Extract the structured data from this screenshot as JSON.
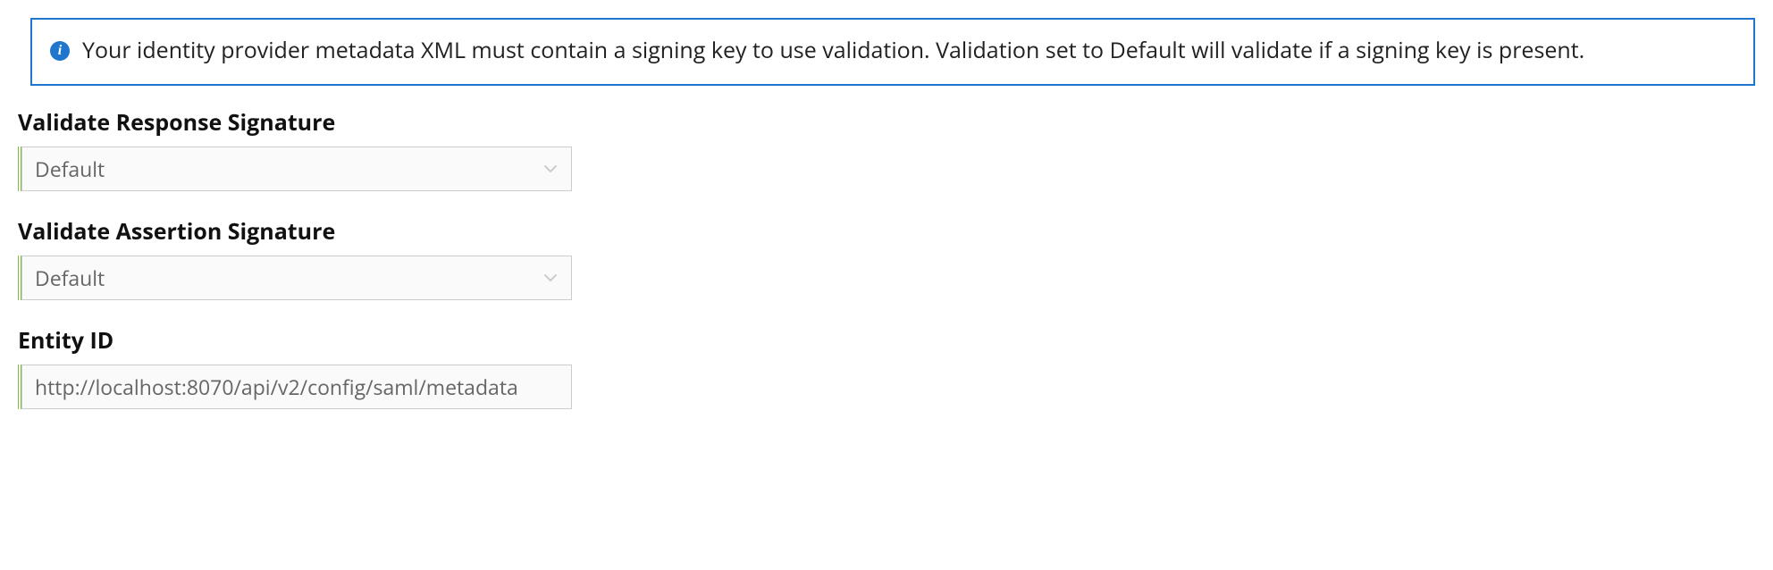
{
  "alert": {
    "text": "Your identity provider metadata XML must contain a signing key to use validation. Validation set to Default will validate if a signing key is present."
  },
  "fields": {
    "validate_response_signature": {
      "label": "Validate Response Signature",
      "value": "Default"
    },
    "validate_assertion_signature": {
      "label": "Validate Assertion Signature",
      "value": "Default"
    },
    "entity_id": {
      "label": "Entity ID",
      "value": "http://localhost:8070/api/v2/config/saml/metadata"
    }
  },
  "colors": {
    "alert_border": "#1f76cc",
    "accent_green": "#7bc043"
  }
}
